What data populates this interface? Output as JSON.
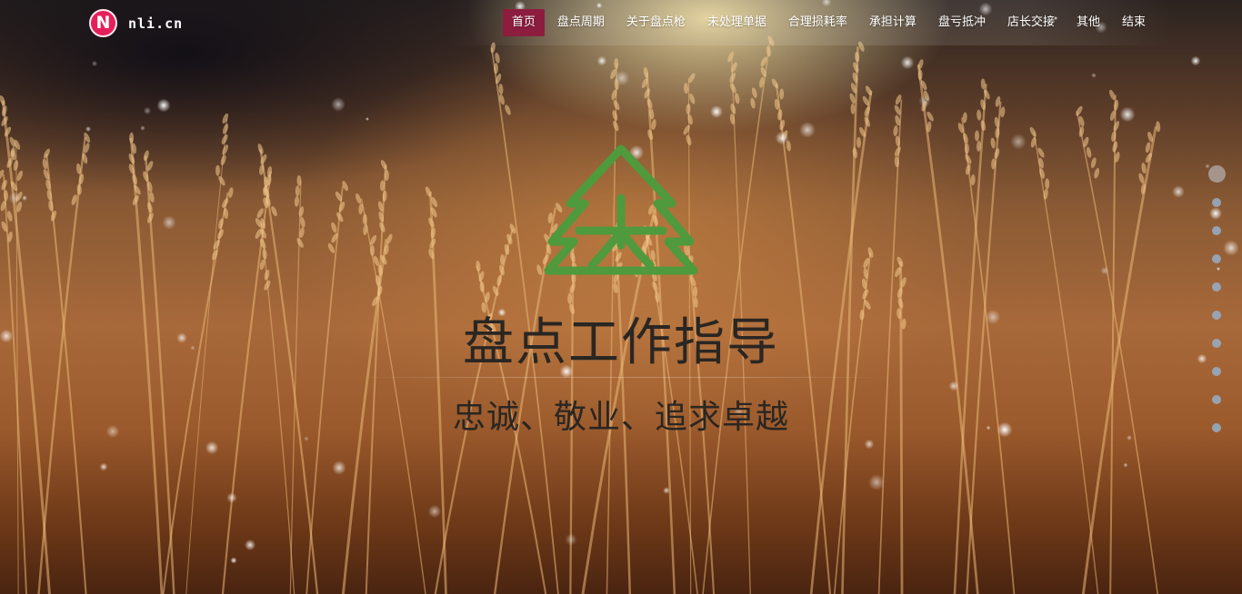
{
  "brand": {
    "logo_letter": "N",
    "name": "nli.cn"
  },
  "nav": {
    "items": [
      {
        "label": "首页",
        "active": true
      },
      {
        "label": "盘点周期",
        "active": false
      },
      {
        "label": "关于盘点枪",
        "active": false
      },
      {
        "label": "未处理单据",
        "active": false
      },
      {
        "label": "合理损耗率",
        "active": false
      },
      {
        "label": "承担计算",
        "active": false
      },
      {
        "label": "盘亏抵冲",
        "active": false
      },
      {
        "label": "店长交接",
        "active": false
      },
      {
        "label": "其他",
        "active": false
      },
      {
        "label": "结束",
        "active": false
      }
    ]
  },
  "hero": {
    "title": "盘点工作指导",
    "subtitle": "忠诚、敬业、追求卓越",
    "emblem_icon": "tree-plus-logo-icon"
  },
  "pagination": {
    "total": 10,
    "current": 1
  },
  "colors": {
    "nav_active": "#8c1d3f",
    "logo_badge": "#e4205a",
    "emblem": "#4f9a3c",
    "hero_text": "#2a2622",
    "dot": "#96afc8"
  }
}
